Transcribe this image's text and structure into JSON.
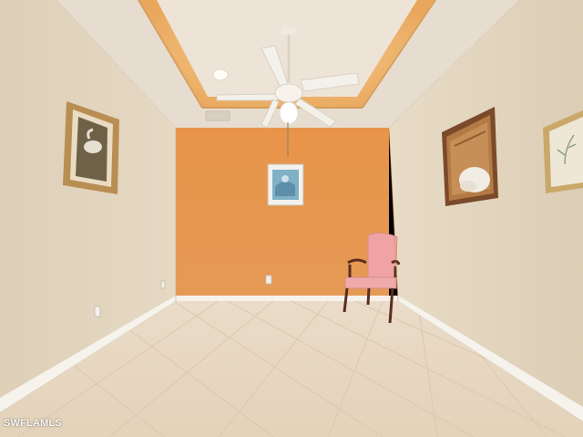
{
  "watermark": {
    "text": "SWFLAMLS"
  },
  "palette": {
    "accent_wall": "#E7954B",
    "side_walls": "#E2D3BC",
    "ceiling": "#E9DFD1",
    "ceiling_cove_glow": "#F2B870",
    "baseboard": "#F7F4EF",
    "floor_tile": "#E8D8C2",
    "chair_upholstery": "#EFA3A4",
    "chair_wood": "#5A2E20"
  },
  "scene_objects": [
    "ceiling-fan",
    "recessed-light",
    "tray-ceiling",
    "orange-accent-wall",
    "framed-art-swan",
    "framed-art-blue-print",
    "framed-art-magnolia",
    "framed-art-botanical",
    "pink-armchair",
    "tile-floor",
    "baseboards",
    "electrical-outlets"
  ]
}
